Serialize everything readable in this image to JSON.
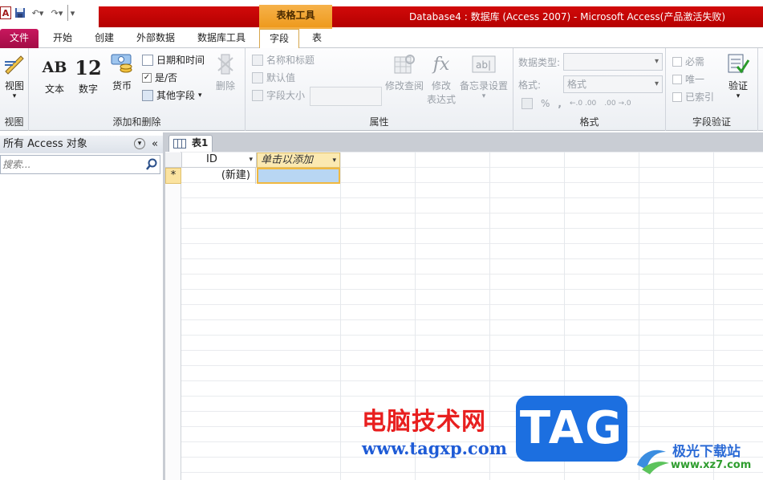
{
  "titlebar": {
    "app_badge": "A",
    "context_group": "表格工具",
    "window_title": "Database4 : 数据库 (Access 2007)  -  Microsoft Access(产品激活失败)"
  },
  "tabs": {
    "file": "文件",
    "home": "开始",
    "create": "创建",
    "external": "外部数据",
    "dbtools": "数据库工具",
    "field": "字段",
    "table": "表"
  },
  "ribbon": {
    "view_group": {
      "view": "视图",
      "label": "视图"
    },
    "add_group": {
      "text": "文本",
      "text_icon": "AB",
      "number": "数字",
      "number_icon": "12",
      "currency": "货币",
      "datetime": "日期和时间",
      "yesno": "是/否",
      "more": "其他字段",
      "delete": "删除",
      "label": "添加和删除"
    },
    "props_group": {
      "name_caption": "名称和标题",
      "default_value": "默认值",
      "field_size": "字段大小",
      "modify_lookup": "修改查阅",
      "modify_expr_1": "修改",
      "modify_expr_2": "表达式",
      "memo": "备忘录设置",
      "label": "属性"
    },
    "format_group": {
      "datatype_label": "数据类型:",
      "format_label": "格式:",
      "format_value": "格式",
      "percent": "%",
      "comma": ",",
      "inc_decimal": "←.0 .00",
      "dec_decimal": ".00 →.0",
      "label": "格式"
    },
    "validation_group": {
      "required": "必需",
      "unique": "唯一",
      "indexed": "已索引",
      "validate": "验证",
      "label": "字段验证"
    }
  },
  "nav": {
    "header": "所有 Access 对象",
    "search_placeholder": "搜索..."
  },
  "doc": {
    "tab_title": "表1",
    "col_id": "ID",
    "col_add": "单击以添加",
    "new_row_marker": "*",
    "new_row_value": "(新建)"
  },
  "watermark": {
    "site_name": "电脑技术网",
    "site_url": "www.tagxp.com",
    "tag": "TAG",
    "logo_text": "极光下载站",
    "logo_url": "www.xz7.com"
  }
}
